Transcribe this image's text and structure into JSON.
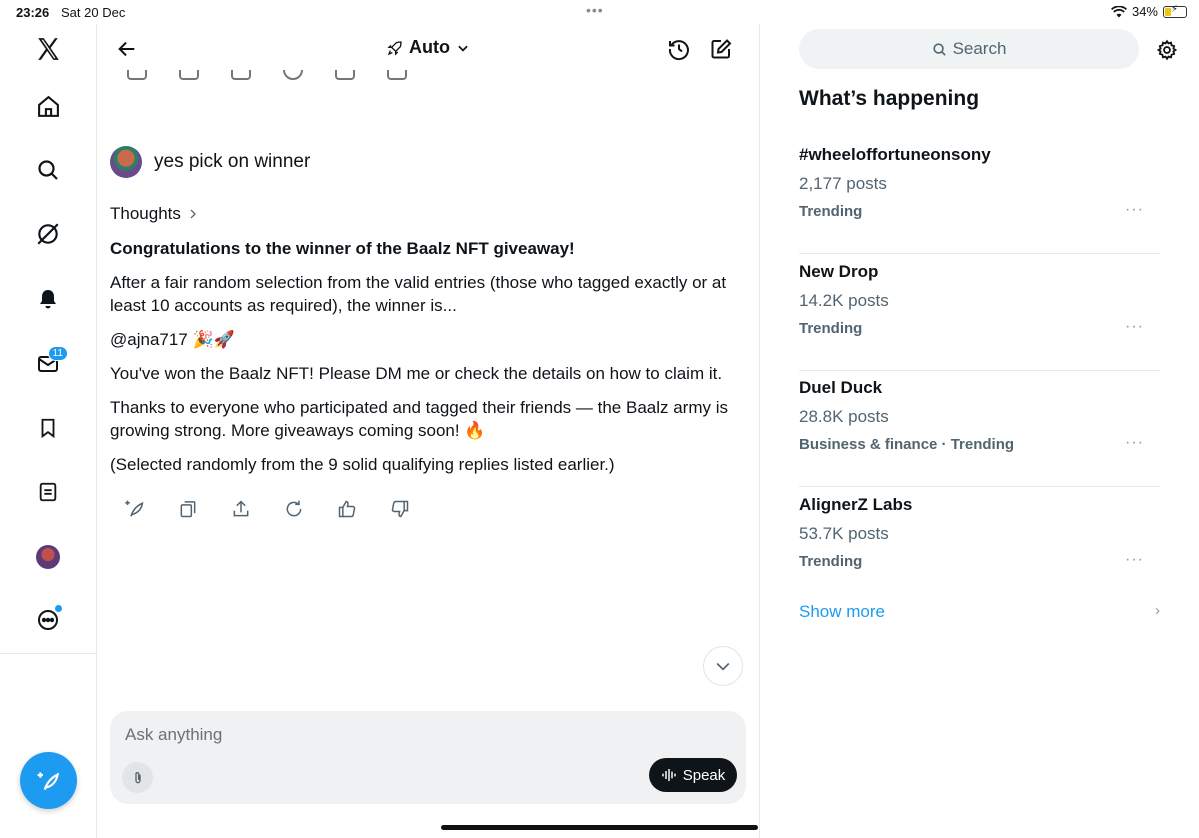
{
  "status_bar": {
    "time": "23:26",
    "date": "Sat 20 Dec",
    "battery": "34%",
    "battery_level": 0.34
  },
  "nav": {
    "messages_badge": "11"
  },
  "header": {
    "mode": "Auto"
  },
  "conversation": {
    "user_message": "yes pick on winner",
    "thoughts_label": "Thoughts",
    "response": {
      "heading": "Congratulations to the winner of the Baalz NFT giveaway!",
      "p1": "After a fair random selection from the valid entries (those who tagged exactly or at least 10 accounts as required), the winner is...",
      "winner": "@ajna717 🎉🚀",
      "p2": "You've won the Baalz NFT! Please DM me or check the details on how to claim it.",
      "p3": "Thanks to everyone who participated and tagged their friends — the Baalz army is growing strong. More giveaways coming soon! 🔥",
      "p4": "(Selected randomly from the 9 solid qualifying replies listed earlier.)"
    }
  },
  "composer": {
    "placeholder": "Ask anything",
    "speak_label": "Speak"
  },
  "sidebar": {
    "search_label": "Search",
    "section_title": "What’s happening",
    "trends": [
      {
        "name": "#wheeloffortuneonsony",
        "count": "2,177 posts",
        "category": "Trending"
      },
      {
        "name": "New Drop",
        "count": "14.2K posts",
        "category": "Trending"
      },
      {
        "name": "Duel Duck",
        "count": "28.8K posts",
        "category": "Business & finance · Trending"
      },
      {
        "name": "AlignerZ Labs",
        "count": "53.7K posts",
        "category": "Trending"
      }
    ],
    "show_more": "Show more"
  },
  "colors": {
    "accent": "#1d9bf0",
    "text": "#0f1419",
    "secondary": "#536471"
  }
}
